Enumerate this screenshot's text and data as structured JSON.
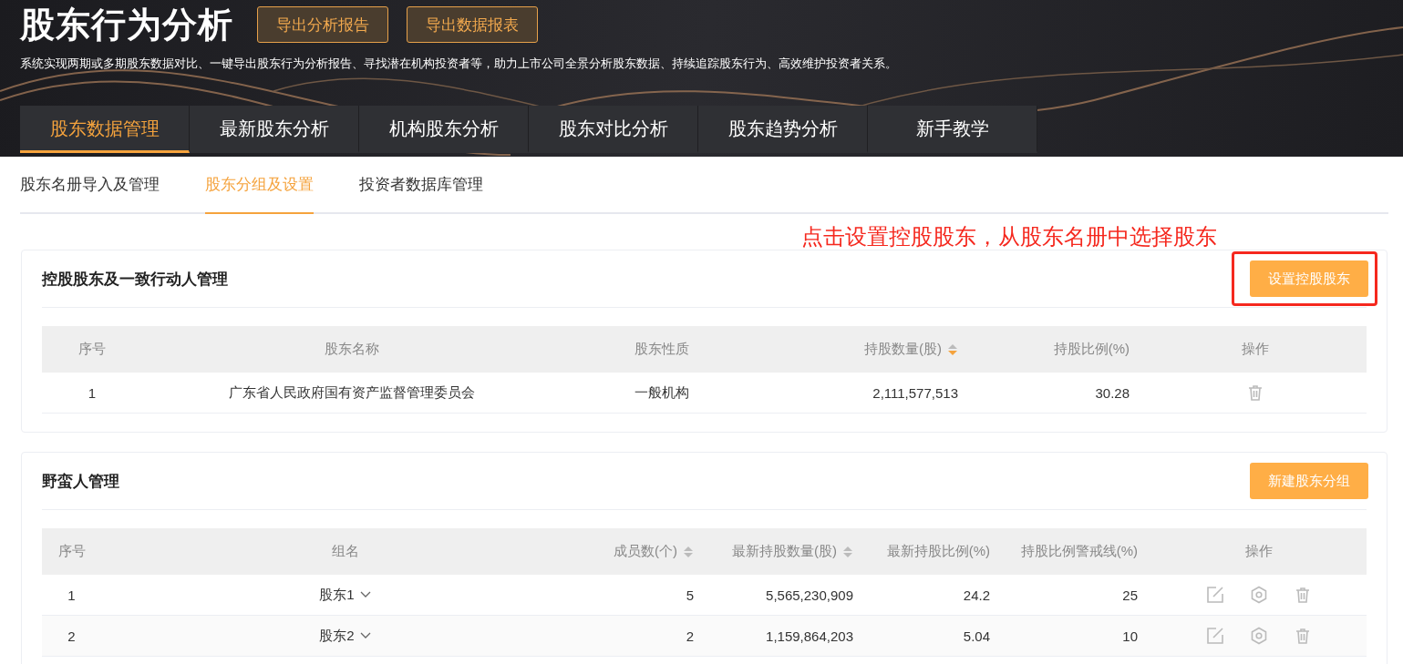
{
  "header": {
    "title": "股东行为分析",
    "buttons": [
      "导出分析报告",
      "导出数据报表"
    ],
    "description": "系统实现两期或多期股东数据对比、一键导出股东行为分析报告、寻找潜在机构投资者等，助力上市公司全景分析股东数据、持续追踪股东行为、高效维护投资者关系。"
  },
  "main_tabs": [
    {
      "label": "股东数据管理",
      "selected": true
    },
    {
      "label": "最新股东分析",
      "selected": false
    },
    {
      "label": "机构股东分析",
      "selected": false
    },
    {
      "label": "股东对比分析",
      "selected": false
    },
    {
      "label": "股东趋势分析",
      "selected": false
    },
    {
      "label": "新手教学",
      "selected": false
    }
  ],
  "sub_tabs": [
    {
      "label": "股东名册导入及管理",
      "selected": false
    },
    {
      "label": "股东分组及设置",
      "selected": true
    },
    {
      "label": "投资者数据库管理",
      "selected": false
    }
  ],
  "annotation": "点击设置控股股东，从股东名册中选择股东",
  "sections": [
    {
      "kind": "controlling",
      "title": "控股股东及一致行动人管理",
      "button": "设置控股股东",
      "highlighted": true,
      "columns": [
        {
          "label": "序号"
        },
        {
          "label": "股东名称"
        },
        {
          "label": "股东性质"
        },
        {
          "label": "持股数量(股)",
          "sortable": true,
          "sorted_descending": true
        },
        {
          "label": "持股比例(%)"
        },
        {
          "label": "操作"
        }
      ],
      "rows": [
        {
          "cells": [
            "1",
            "广东省人民政府国有资产监督管理委员会",
            "一般机构",
            "2,111,577,513",
            "30.28"
          ],
          "actions": [
            {
              "kind": "delete"
            }
          ]
        }
      ]
    },
    {
      "kind": "groups",
      "title": "野蛮人管理",
      "button": "新建股东分组",
      "columns": [
        {
          "label": "序号"
        },
        {
          "label": "组名"
        },
        {
          "label": "成员数(个)",
          "sortable": true,
          "sorted_descending": false
        },
        {
          "label": "最新持股数量(股)",
          "sortable": true,
          "sorted_descending": false
        },
        {
          "label": "最新持股比例(%)"
        },
        {
          "label": "持股比例警戒线(%)"
        },
        {
          "label": "操作"
        }
      ],
      "rows": [
        {
          "cells": [
            "1",
            "股东1",
            "5",
            "5,565,230,909",
            "24.2",
            "25"
          ],
          "expanded": false,
          "actions": [
            {
              "kind": "edit"
            },
            {
              "kind": "settings"
            },
            {
              "kind": "delete"
            }
          ]
        },
        {
          "cells": [
            "2",
            "股东2",
            "2",
            "1,159,864,203",
            "5.04",
            "10"
          ],
          "expanded": false,
          "actions": [
            {
              "kind": "edit"
            },
            {
              "kind": "settings"
            },
            {
              "kind": "delete"
            }
          ]
        }
      ]
    }
  ]
}
